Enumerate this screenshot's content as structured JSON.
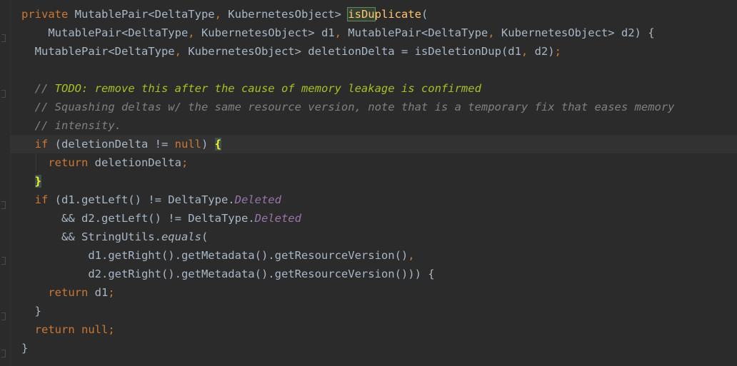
{
  "editor": {
    "theme": "darcula",
    "colors": {
      "background": "#2b2b2b",
      "keyword": "#cc7832",
      "text": "#a9b7c6",
      "method": "#ffc66d",
      "comment": "#808080",
      "todo": "#a8c023",
      "constant": "#9876aa"
    },
    "lines": [
      {
        "tokens": [
          {
            "t": "private ",
            "c": "keyword"
          },
          {
            "t": "MutablePair<DeltaType",
            "c": "plain"
          },
          {
            "t": ", ",
            "c": "punct"
          },
          {
            "t": "KubernetesObject> ",
            "c": "plain"
          },
          {
            "t": "isDu",
            "c": "highlight"
          },
          {
            "t": "plicate",
            "c": "method"
          },
          {
            "t": "(",
            "c": "plain"
          }
        ]
      },
      {
        "tokens": [
          {
            "t": "    MutablePair<DeltaType",
            "c": "plain"
          },
          {
            "t": ", ",
            "c": "punct"
          },
          {
            "t": "KubernetesObject> d1",
            "c": "plain"
          },
          {
            "t": ", ",
            "c": "punct"
          },
          {
            "t": "MutablePair<DeltaType",
            "c": "plain"
          },
          {
            "t": ", ",
            "c": "punct"
          },
          {
            "t": "KubernetesObject> d2) {",
            "c": "plain"
          }
        ]
      },
      {
        "tokens": [
          {
            "t": "  MutablePair<DeltaType",
            "c": "plain"
          },
          {
            "t": ", ",
            "c": "punct"
          },
          {
            "t": "KubernetesObject> deletionDelta = isDeletionDup(d1",
            "c": "plain"
          },
          {
            "t": ", ",
            "c": "punct"
          },
          {
            "t": "d2)",
            "c": "plain"
          },
          {
            "t": ";",
            "c": "punct"
          }
        ]
      },
      {
        "tokens": []
      },
      {
        "tokens": [
          {
            "t": "  // ",
            "c": "comment"
          },
          {
            "t": "TODO: remove this after the cause of memory leakage is confirmed",
            "c": "todo"
          }
        ]
      },
      {
        "tokens": [
          {
            "t": "  // Squashing deltas w/ the same resource version, note that is a temporary fix that eases memory",
            "c": "comment"
          }
        ]
      },
      {
        "tokens": [
          {
            "t": "  // intensity.",
            "c": "comment"
          }
        ]
      },
      {
        "current": true,
        "tokens": [
          {
            "t": "  if ",
            "c": "keyword"
          },
          {
            "t": "(deletionDelta != ",
            "c": "plain"
          },
          {
            "t": "null",
            "c": "keyword"
          },
          {
            "t": ") ",
            "c": "plain"
          },
          {
            "t": "{",
            "c": "brace-match"
          }
        ]
      },
      {
        "tokens": [
          {
            "t": "    return ",
            "c": "keyword"
          },
          {
            "t": "deletionDelta",
            "c": "plain"
          },
          {
            "t": ";",
            "c": "punct"
          }
        ]
      },
      {
        "tokens": [
          {
            "t": "  ",
            "c": "plain"
          },
          {
            "t": "}",
            "c": "brace-match"
          }
        ]
      },
      {
        "tokens": [
          {
            "t": "  if ",
            "c": "keyword"
          },
          {
            "t": "(d1.getLeft() != DeltaType.",
            "c": "plain"
          },
          {
            "t": "Deleted",
            "c": "const"
          }
        ]
      },
      {
        "tokens": [
          {
            "t": "      && d2.getLeft() != DeltaType.",
            "c": "plain"
          },
          {
            "t": "Deleted",
            "c": "const"
          }
        ]
      },
      {
        "tokens": [
          {
            "t": "      && StringUtils.",
            "c": "plain"
          },
          {
            "t": "equals",
            "c": "static"
          },
          {
            "t": "(",
            "c": "plain"
          }
        ]
      },
      {
        "tokens": [
          {
            "t": "          d1.getRight().getMetadata().getResourceVersion()",
            "c": "plain"
          },
          {
            "t": ",",
            "c": "punct"
          }
        ]
      },
      {
        "tokens": [
          {
            "t": "          d2.getRight().getMetadata().getResourceVersion())) {",
            "c": "plain"
          }
        ]
      },
      {
        "tokens": [
          {
            "t": "    return ",
            "c": "keyword"
          },
          {
            "t": "d1",
            "c": "plain"
          },
          {
            "t": ";",
            "c": "punct"
          }
        ]
      },
      {
        "tokens": [
          {
            "t": "  }",
            "c": "plain"
          }
        ]
      },
      {
        "tokens": [
          {
            "t": "  return ",
            "c": "keyword"
          },
          {
            "t": "null",
            "c": "keyword"
          },
          {
            "t": ";",
            "c": "punct"
          }
        ]
      },
      {
        "tokens": [
          {
            "t": "}",
            "c": "plain"
          }
        ]
      }
    ]
  }
}
